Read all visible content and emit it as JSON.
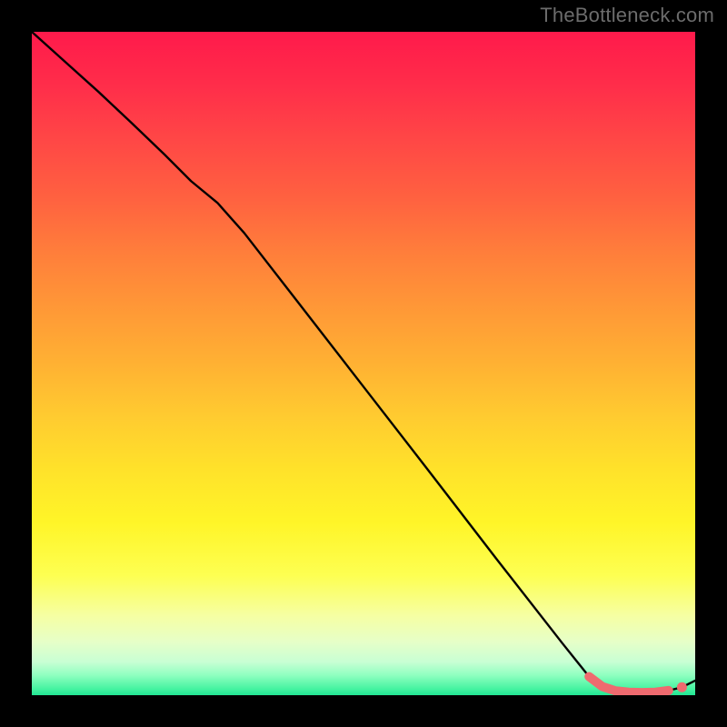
{
  "watermark": "TheBottleneck.com",
  "colors": {
    "background": "#000000",
    "gradient_top": "#ff1a4b",
    "gradient_mid": "#ffe22a",
    "gradient_bottom": "#22e693",
    "curve": "#000000",
    "marker": "#ef6a6f",
    "watermark_text": "#6c6c6c"
  },
  "chart_data": {
    "type": "line",
    "title": "",
    "xlabel": "",
    "ylabel": "",
    "x": [
      0.0,
      0.05,
      0.1,
      0.15,
      0.2,
      0.24,
      0.28,
      0.32,
      0.4,
      0.5,
      0.6,
      0.7,
      0.8,
      0.84,
      0.86,
      0.88,
      0.9,
      0.92,
      0.94,
      0.96,
      0.98,
      1.0
    ],
    "values": [
      1.0,
      0.955,
      0.91,
      0.863,
      0.815,
      0.775,
      0.742,
      0.697,
      0.594,
      0.465,
      0.336,
      0.206,
      0.078,
      0.028,
      0.013,
      0.0065,
      0.0045,
      0.004,
      0.0045,
      0.007,
      0.012,
      0.022
    ],
    "xlim": [
      0,
      1
    ],
    "ylim": [
      0,
      1
    ],
    "markers": {
      "zone_start_x": 0.84,
      "zone_end_x": 0.96,
      "end_point_x": 0.98
    }
  }
}
